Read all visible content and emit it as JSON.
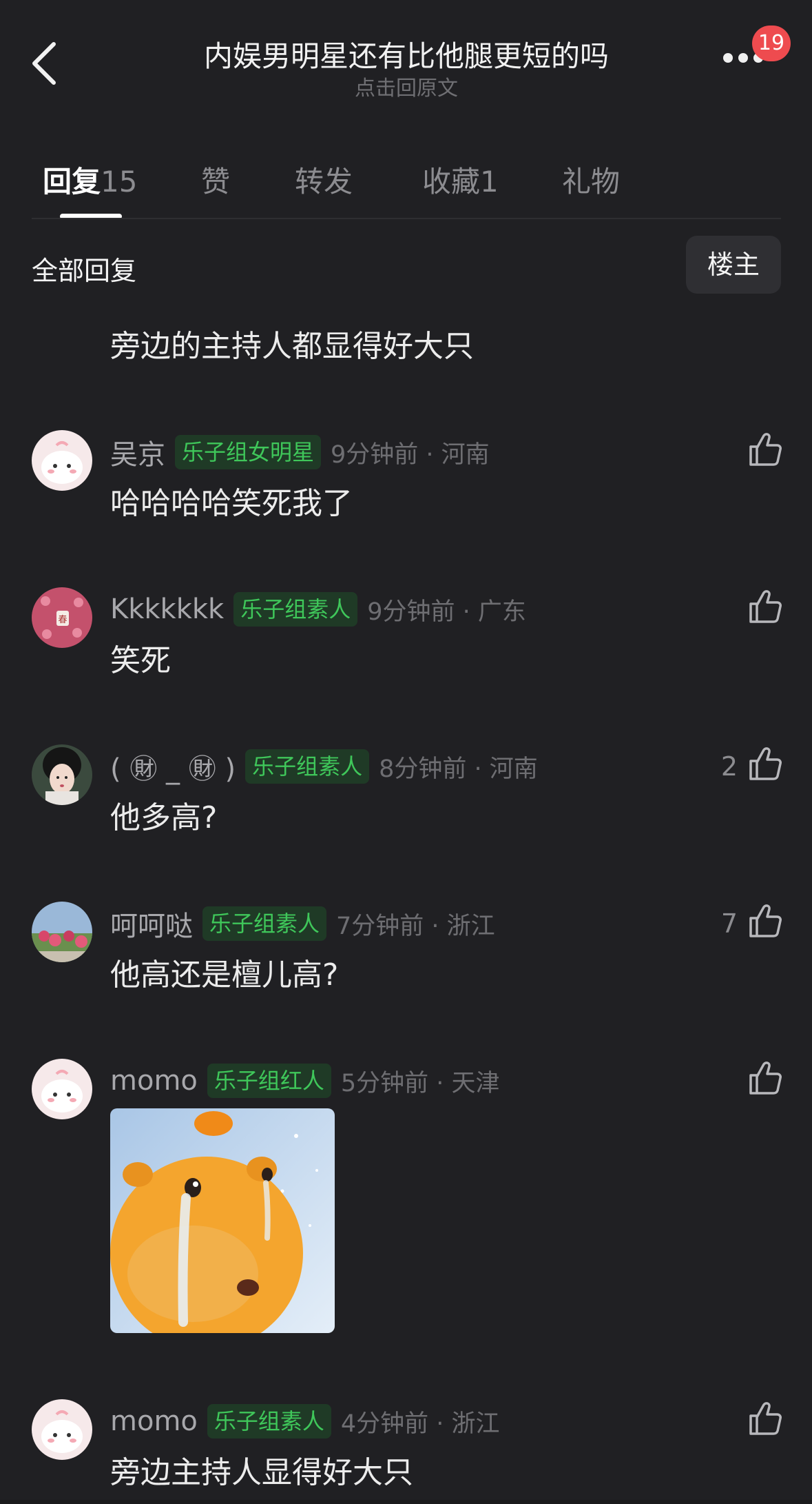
{
  "header": {
    "title": "内娱男明星还有比他腿更短的吗",
    "subtitle": "点击回原文",
    "notification_count": "19",
    "back_icon": "chevron-left-icon",
    "more_icon": "more-dots-icon"
  },
  "tabs": [
    {
      "label": "回复",
      "count": "15"
    },
    {
      "label": "赞",
      "count": ""
    },
    {
      "label": "转发",
      "count": ""
    },
    {
      "label": "收藏",
      "count": "1"
    },
    {
      "label": "礼物",
      "count": ""
    }
  ],
  "filter": {
    "all_replies_label": "全部回复",
    "op_button_label": "楼主"
  },
  "partial_comment_text": "旁边的主持人都显得好大只",
  "comments": [
    {
      "username": "吴京",
      "tag": "乐子组女明星",
      "time": "9分钟前 · 河南",
      "text": "哈哈哈哈笑死我了",
      "likes": ""
    },
    {
      "username": "Kkkkkkk",
      "tag": "乐子组素人",
      "time": "9分钟前 · 广东",
      "text": "笑死",
      "likes": ""
    },
    {
      "username": "( ㊖ _ ㊖ )",
      "tag": "乐子组素人",
      "time": "8分钟前 · 河南",
      "text": "他多高?",
      "likes": "2"
    },
    {
      "username": "呵呵哒",
      "tag": "乐子组素人",
      "time": "7分钟前 · 浙江",
      "text": "他高还是檀儿高?",
      "likes": "7"
    },
    {
      "username": "momo",
      "tag": "乐子组红人",
      "time": "5分钟前 · 天津",
      "text": "",
      "likes": "",
      "sticker": "crying-capybara-sticker"
    },
    {
      "username": "momo",
      "tag": "乐子组素人",
      "time": "4分钟前 · 浙江",
      "text": "旁边主持人显得好大只",
      "likes": ""
    }
  ],
  "colors": {
    "background": "#202023",
    "tag_bg": "#1f3a26",
    "tag_text": "#3fc75a",
    "badge": "#ee4b4f"
  }
}
